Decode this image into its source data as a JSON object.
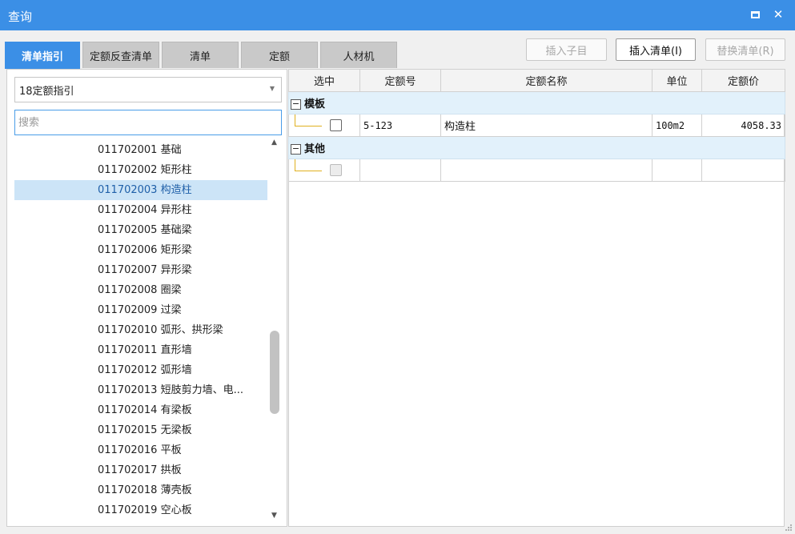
{
  "window": {
    "title": "查询"
  },
  "tabs": [
    {
      "label": "清单指引",
      "active": true
    },
    {
      "label": "定额反查清单",
      "active": false
    },
    {
      "label": "清单",
      "active": false
    },
    {
      "label": "定额",
      "active": false
    },
    {
      "label": "人材机",
      "active": false
    }
  ],
  "toolbar": {
    "insert_child": "插入子目",
    "insert_list": "插入清单(I)",
    "replace_list": "替换清单(R)"
  },
  "left": {
    "combo_value": "18定额指引",
    "search_placeholder": "搜索",
    "items": [
      {
        "code": "011702001",
        "name": "基础",
        "label": "011702001  基础"
      },
      {
        "code": "011702002",
        "name": "矩形柱",
        "label": "011702002  矩形柱"
      },
      {
        "code": "011702003",
        "name": "构造柱",
        "label": "011702003  构造柱",
        "selected": true
      },
      {
        "code": "011702004",
        "name": "异形柱",
        "label": "011702004  异形柱"
      },
      {
        "code": "011702005",
        "name": "基础梁",
        "label": "011702005  基础梁"
      },
      {
        "code": "011702006",
        "name": "矩形梁",
        "label": "011702006  矩形梁"
      },
      {
        "code": "011702007",
        "name": "异形梁",
        "label": "011702007  异形梁"
      },
      {
        "code": "011702008",
        "name": "圈梁",
        "label": "011702008  圈梁"
      },
      {
        "code": "011702009",
        "name": "过梁",
        "label": "011702009  过梁"
      },
      {
        "code": "011702010",
        "name": "弧形、拱形梁",
        "label": "011702010  弧形、拱形梁"
      },
      {
        "code": "011702011",
        "name": "直形墙",
        "label": "011702011  直形墙"
      },
      {
        "code": "011702012",
        "name": "弧形墙",
        "label": "011702012  弧形墙"
      },
      {
        "code": "011702013",
        "name": "短肢剪力墙、电...",
        "label": "011702013  短肢剪力墙、电..."
      },
      {
        "code": "011702014",
        "name": "有梁板",
        "label": "011702014  有梁板"
      },
      {
        "code": "011702015",
        "name": "无梁板",
        "label": "011702015  无梁板"
      },
      {
        "code": "011702016",
        "name": "平板",
        "label": "011702016  平板"
      },
      {
        "code": "011702017",
        "name": "拱板",
        "label": "011702017  拱板"
      },
      {
        "code": "011702018",
        "name": "薄壳板",
        "label": "011702018  薄壳板"
      },
      {
        "code": "011702019",
        "name": "空心板",
        "label": "011702019  空心板"
      }
    ]
  },
  "grid": {
    "columns": [
      "选中",
      "定额号",
      "定额名称",
      "单位",
      "定额价"
    ],
    "groups": [
      {
        "expander": "−",
        "name": "模板",
        "rows": [
          {
            "checked": false,
            "disabled": false,
            "code": "5-123",
            "name": "构造柱",
            "unit": "100m2",
            "price": "4058.33"
          }
        ]
      },
      {
        "expander": "−",
        "name": "其他",
        "rows": [
          {
            "checked": false,
            "disabled": true,
            "code": "",
            "name": "",
            "unit": "",
            "price": ""
          }
        ]
      }
    ]
  }
}
